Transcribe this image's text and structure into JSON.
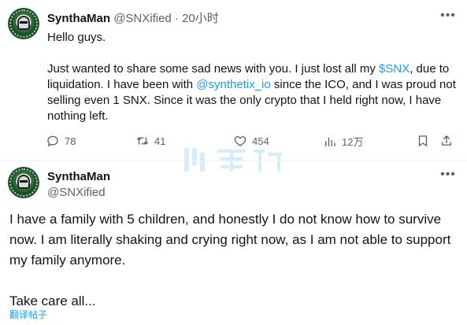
{
  "tweet1": {
    "author_name": "SynthaMan",
    "author_handle": "@SNXified",
    "separator": "·",
    "timestamp": "20小时",
    "more_icon": "more-horizontal-icon",
    "greeting": "Hello guys.",
    "body_part1": "Just wanted to share some sad news with you. I just lost all my ",
    "cashtag": "$SNX",
    "body_part2": ", due to liquidation. I have been with ",
    "mention": "@synthetix_io",
    "body_part3": " since the ICO, and I was proud not selling even 1 SNX. Since it was the only crypto that I held right now, I have nothing left.",
    "actions": {
      "replies": "78",
      "retweets": "41",
      "likes": "454",
      "views": "12万"
    }
  },
  "tweet2": {
    "author_name": "SynthaMan",
    "author_handle": "@SNXified",
    "paragraph1": "I have a family with 5 children, and honestly I do not know how to survive now. I am literally shaking and crying right  now, as I am not able to support my family anymore.",
    "paragraph2": "Take care all...",
    "translate_link": "翻译帖子"
  },
  "colors": {
    "accent": "#1d9bf0",
    "muted": "#536471",
    "text": "#0f1419",
    "divider": "#eff3f4"
  }
}
